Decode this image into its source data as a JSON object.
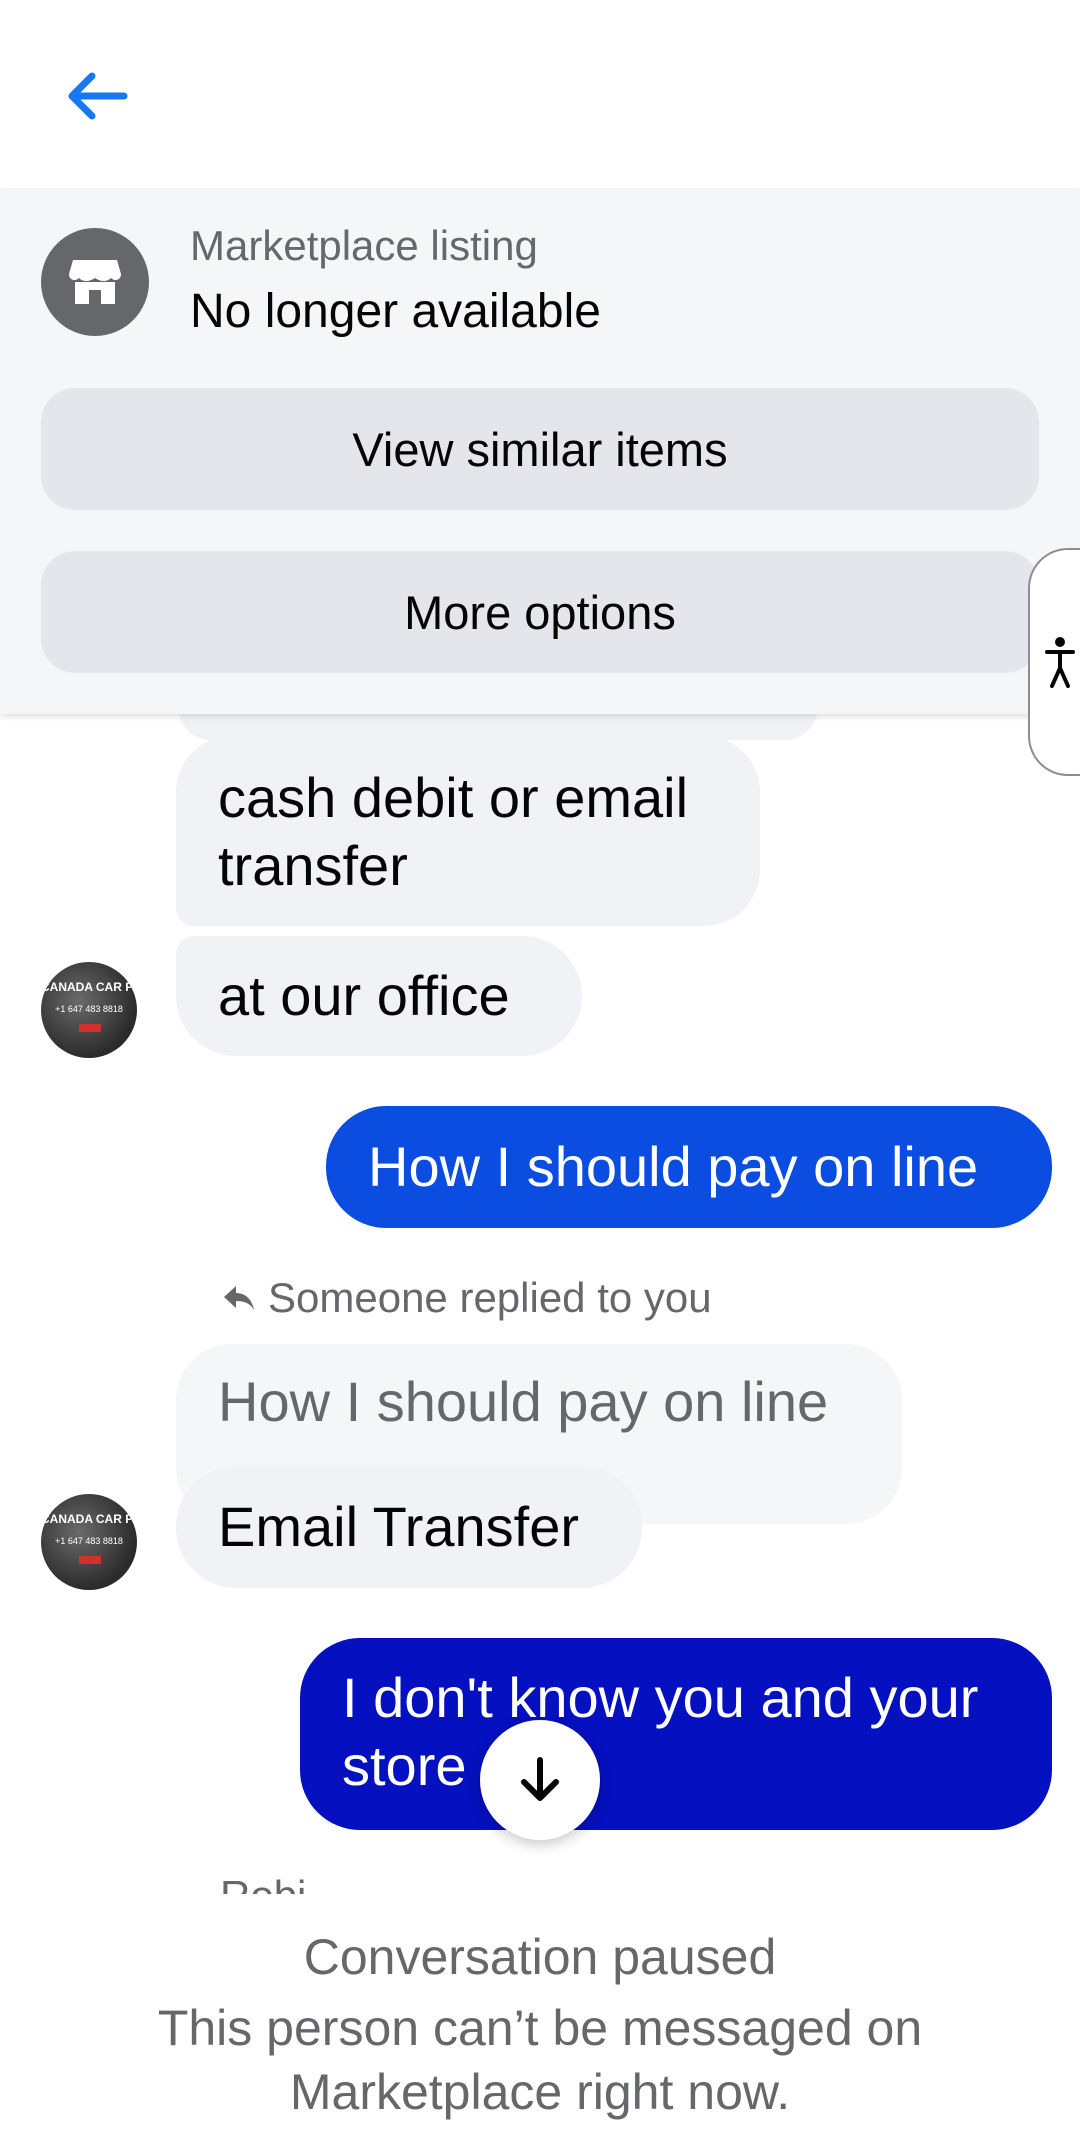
{
  "header": {
    "back_icon": "arrow-left-icon",
    "accent": "#1877f2"
  },
  "listing": {
    "kicker": "Marketplace listing",
    "status": "No longer available",
    "store_icon": "store-icon",
    "buttons": {
      "view_similar": "View similar items",
      "more_options": "More options"
    }
  },
  "accessibility": {
    "icon": "accessibility-icon"
  },
  "messages": [
    {
      "id": "m1",
      "direction": "in",
      "text": "cash debit or email transfer"
    },
    {
      "id": "m2",
      "direction": "in",
      "text": "at our office",
      "avatar_text": "CANADA CAR PARTS",
      "avatar_sub": "+1 647 483 8818"
    },
    {
      "id": "m3",
      "direction": "out",
      "text": "How I should pay on line"
    },
    {
      "id": "m4",
      "direction": "in",
      "reply_notice": "Someone replied to you",
      "quoted_text": "How I should pay on line",
      "text": "Email Transfer",
      "avatar_text": "CANADA CAR PARTS",
      "avatar_sub": "+1 647 483 8818"
    },
    {
      "id": "m5",
      "direction": "out",
      "text": "I don't know you and your store"
    }
  ],
  "colors": {
    "outgoing_1": "#0a4de0",
    "outgoing_2": "#0510c0",
    "incoming": "#f0f2f5"
  },
  "scroll_down_icon": "arrow-down-icon",
  "sender_peek": "Robi...",
  "footer": {
    "title": "Conversation paused",
    "message": "This person can’t be messaged on Marketplace right now."
  }
}
